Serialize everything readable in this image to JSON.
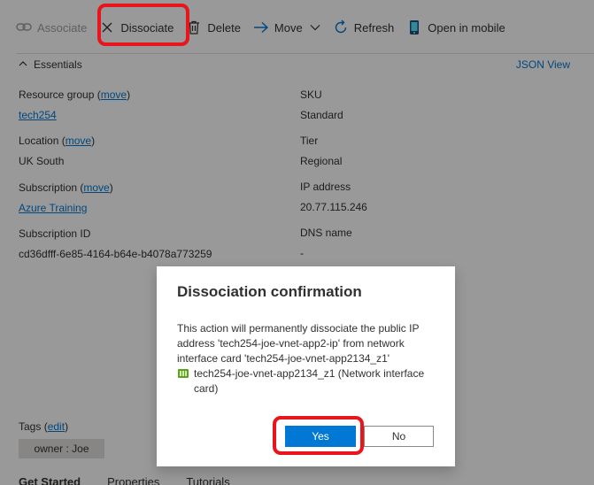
{
  "toolbar": {
    "associate": "Associate",
    "dissociate": "Dissociate",
    "delete": "Delete",
    "move": "Move",
    "refresh": "Refresh",
    "open_mobile": "Open in mobile"
  },
  "essentials": {
    "label": "Essentials",
    "json_view": "JSON View",
    "resource_group_label": "Resource group",
    "resource_group_value": "tech254",
    "location_label": "Location",
    "location_value": "UK South",
    "subscription_label": "Subscription",
    "subscription_value": "Azure Training",
    "subscription_id_label": "Subscription ID",
    "subscription_id_value": "cd36dfff-6e85-4164-b64e-b4078a773259",
    "move_link": "move",
    "sku_label": "SKU",
    "sku_value": "Standard",
    "tier_label": "Tier",
    "tier_value": "Regional",
    "ip_label": "IP address",
    "ip_value": "20.77.115.246",
    "dns_label": "DNS name",
    "dns_value": "-"
  },
  "tags": {
    "label": "Tags",
    "edit": "edit",
    "chip": "owner : Joe"
  },
  "tabs": [
    "Get Started",
    "Properties",
    "Tutorials"
  ],
  "dialog": {
    "title": "Dissociation confirmation",
    "message": "This action will permanently dissociate the public IP address 'tech254-joe-vnet-app2-ip' from network interface card 'tech254-joe-vnet-app2134_z1'",
    "nic": "tech254-joe-vnet-app2134_z1 (Network interface card)",
    "yes": "Yes",
    "no": "No"
  },
  "colors": {
    "accent": "#0078d4",
    "annotation": "#e8161c",
    "nic_icon": "#5ea11f"
  },
  "icons": {
    "associate": "link-icon",
    "dissociate": "close-icon",
    "delete": "trash-icon",
    "move": "arrow-right-icon",
    "refresh": "refresh-icon",
    "open_mobile": "mobile-icon",
    "nic": "network-interface-icon"
  }
}
